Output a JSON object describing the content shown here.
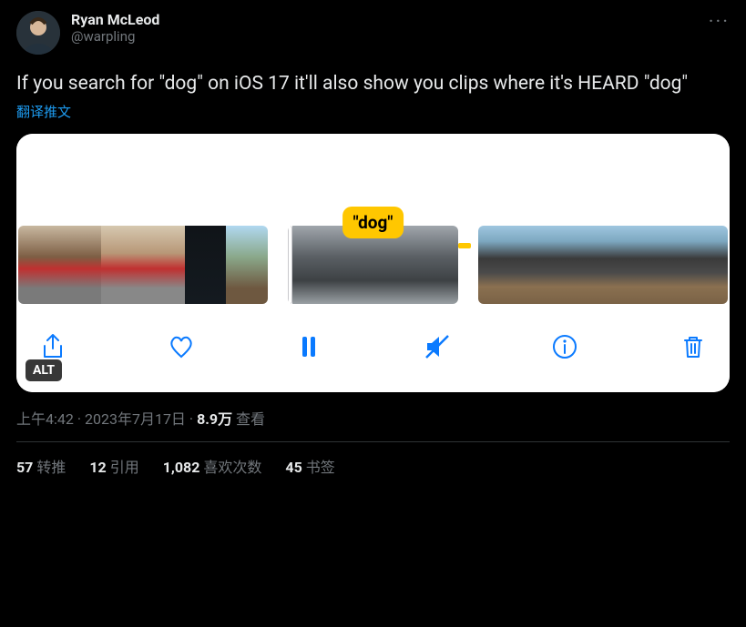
{
  "author": {
    "display_name": "Ryan McLeod",
    "handle": "@warpling"
  },
  "tweet_text": "If you search for \"dog\" on iOS 17 it'll also show you clips where it's HEARD \"dog\"",
  "translate_label": "翻译推文",
  "media": {
    "caption_badge": "\"dog\"",
    "alt_badge": "ALT"
  },
  "meta": {
    "time": "上午4:42",
    "date": "2023年7月17日",
    "views_number": "8.9万",
    "views_label": "查看"
  },
  "stats": {
    "retweets": {
      "count": "57",
      "label": "转推"
    },
    "quotes": {
      "count": "12",
      "label": "引用"
    },
    "likes": {
      "count": "1,082",
      "label": "喜欢次数"
    },
    "bookmarks": {
      "count": "45",
      "label": "书签"
    }
  }
}
